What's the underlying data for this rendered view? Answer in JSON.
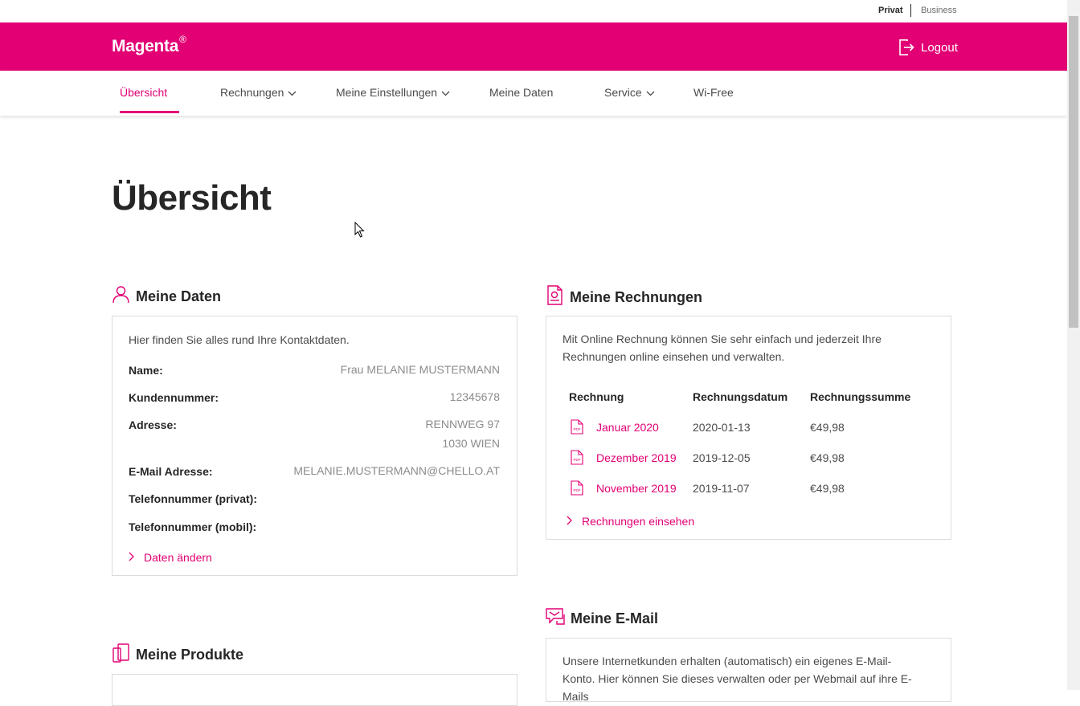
{
  "topbar": {
    "privat": "Privat",
    "business": "Business"
  },
  "brand": {
    "name": "Magenta",
    "mark": "®"
  },
  "header": {
    "logout_label": "Logout"
  },
  "nav": {
    "items": [
      {
        "label": "Übersicht",
        "active": true
      },
      {
        "label": "Rechnungen",
        "dropdown": true
      },
      {
        "label": "Meine Einstellungen",
        "dropdown": true
      },
      {
        "label": "Meine Daten"
      },
      {
        "label": "Service",
        "dropdown": true
      },
      {
        "label": "Wi-Free"
      }
    ]
  },
  "page": {
    "title": "Übersicht"
  },
  "daten": {
    "heading": "Meine Daten",
    "intro": "Hier finden Sie alles rund Ihre Kontaktdaten.",
    "name_label": "Name:",
    "name_value": "Frau MELANIE MUSTERMANN",
    "kunde_label": "Kundennummer:",
    "kunde_value": "12345678",
    "adresse_label": "Adresse:",
    "adresse_line1": "RENNWEG 97",
    "adresse_line2": "1030 WIEN",
    "email_label": "E-Mail Adresse:",
    "email_value": "MELANIE.MUSTERMANN@CHELLO.AT",
    "tel_privat_label": "Telefonnummer (privat):",
    "tel_mobil_label": "Telefonnummer (mobil):",
    "link_label": "Daten ändern"
  },
  "rechnungen": {
    "heading": "Meine Rechnungen",
    "intro": "Mit Online Rechnung können Sie sehr einfach und jederzeit Ihre Rechnungen online einsehen und verwalten.",
    "columns": [
      "Rechnung",
      "Rechnungsdatum",
      "Rechnungssumme"
    ],
    "rows": [
      {
        "name": "Januar 2020",
        "date": "2020-01-13",
        "sum": "€49,98"
      },
      {
        "name": "Dezember 2019",
        "date": "2019-12-05",
        "sum": "€49,98"
      },
      {
        "name": "November 2019",
        "date": "2019-11-07",
        "sum": "€49,98"
      }
    ],
    "link_label": "Rechnungen einsehen"
  },
  "email": {
    "heading": "Meine E-Mail",
    "intro": "Unsere Internetkunden erhalten (automatisch) ein eigenes E-Mail-Konto. Hier können Sie dieses verwalten oder per Webmail auf ihre E-Mails"
  },
  "produkte": {
    "heading": "Meine Produkte"
  },
  "colors": {
    "accent": "#e20074",
    "text": "#262626",
    "muted": "#8c8c8c",
    "border": "#dcdcdc"
  }
}
